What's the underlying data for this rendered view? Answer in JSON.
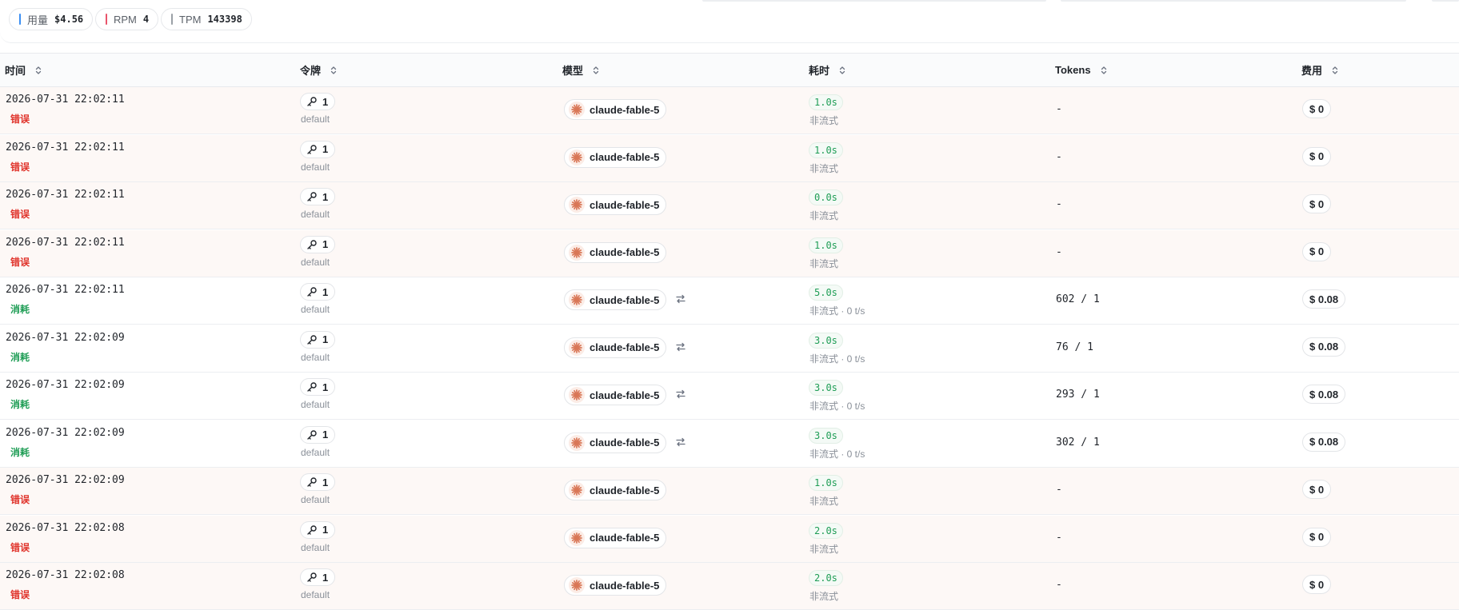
{
  "stats": {
    "usage": {
      "label": "用量",
      "value": "$4.56",
      "color": "#3b8ff3"
    },
    "rpm": {
      "label": "RPM",
      "value": "4",
      "color": "#e9546b"
    },
    "tpm": {
      "label": "TPM",
      "value": "143398",
      "color": "#9aa0a6"
    }
  },
  "columns": {
    "time": "时间",
    "token": "令牌",
    "model": "模型",
    "duration": "耗时",
    "tokens": "Tokens",
    "cost": "费用"
  },
  "icons": {
    "token": "key-icon",
    "model": "claude-logo-icon",
    "redirect": "model-redirect-icon",
    "sort": "sort-icon"
  },
  "colors": {
    "error": "#e0332b",
    "consume": "#1e9d55",
    "claude": "#d97757"
  },
  "rows": [
    {
      "time": "2026-07-31 22:02:11",
      "status": "错误",
      "type": "err",
      "token": "1",
      "group": "default",
      "model": "claude-fable-5",
      "redirect": false,
      "duration": "1.0s",
      "mode": "非流式",
      "tokens": "-",
      "cost": "$ 0"
    },
    {
      "time": "2026-07-31 22:02:11",
      "status": "错误",
      "type": "err",
      "token": "1",
      "group": "default",
      "model": "claude-fable-5",
      "redirect": false,
      "duration": "1.0s",
      "mode": "非流式",
      "tokens": "-",
      "cost": "$ 0"
    },
    {
      "time": "2026-07-31 22:02:11",
      "status": "错误",
      "type": "err",
      "token": "1",
      "group": "default",
      "model": "claude-fable-5",
      "redirect": false,
      "duration": "0.0s",
      "mode": "非流式",
      "tokens": "-",
      "cost": "$ 0"
    },
    {
      "time": "2026-07-31 22:02:11",
      "status": "错误",
      "type": "err",
      "token": "1",
      "group": "default",
      "model": "claude-fable-5",
      "redirect": false,
      "duration": "1.0s",
      "mode": "非流式",
      "tokens": "-",
      "cost": "$ 0"
    },
    {
      "time": "2026-07-31 22:02:11",
      "status": "消耗",
      "type": "ok",
      "token": "1",
      "group": "default",
      "model": "claude-fable-5",
      "redirect": true,
      "duration": "5.0s",
      "mode": "非流式 · 0 t/s",
      "tokens": "602 / 1",
      "cost": "$ 0.08"
    },
    {
      "time": "2026-07-31 22:02:09",
      "status": "消耗",
      "type": "ok",
      "token": "1",
      "group": "default",
      "model": "claude-fable-5",
      "redirect": true,
      "duration": "3.0s",
      "mode": "非流式 · 0 t/s",
      "tokens": "76 / 1",
      "cost": "$ 0.08"
    },
    {
      "time": "2026-07-31 22:02:09",
      "status": "消耗",
      "type": "ok",
      "token": "1",
      "group": "default",
      "model": "claude-fable-5",
      "redirect": true,
      "duration": "3.0s",
      "mode": "非流式 · 0 t/s",
      "tokens": "293 / 1",
      "cost": "$ 0.08"
    },
    {
      "time": "2026-07-31 22:02:09",
      "status": "消耗",
      "type": "ok",
      "token": "1",
      "group": "default",
      "model": "claude-fable-5",
      "redirect": true,
      "duration": "3.0s",
      "mode": "非流式 · 0 t/s",
      "tokens": "302 / 1",
      "cost": "$ 0.08"
    },
    {
      "time": "2026-07-31 22:02:09",
      "status": "错误",
      "type": "err",
      "token": "1",
      "group": "default",
      "model": "claude-fable-5",
      "redirect": false,
      "duration": "1.0s",
      "mode": "非流式",
      "tokens": "-",
      "cost": "$ 0"
    },
    {
      "time": "2026-07-31 22:02:08",
      "status": "错误",
      "type": "err",
      "token": "1",
      "group": "default",
      "model": "claude-fable-5",
      "redirect": false,
      "duration": "2.0s",
      "mode": "非流式",
      "tokens": "-",
      "cost": "$ 0"
    },
    {
      "time": "2026-07-31 22:02:08",
      "status": "错误",
      "type": "err",
      "token": "1",
      "group": "default",
      "model": "claude-fable-5",
      "redirect": false,
      "duration": "2.0s",
      "mode": "非流式",
      "tokens": "-",
      "cost": "$ 0"
    }
  ]
}
